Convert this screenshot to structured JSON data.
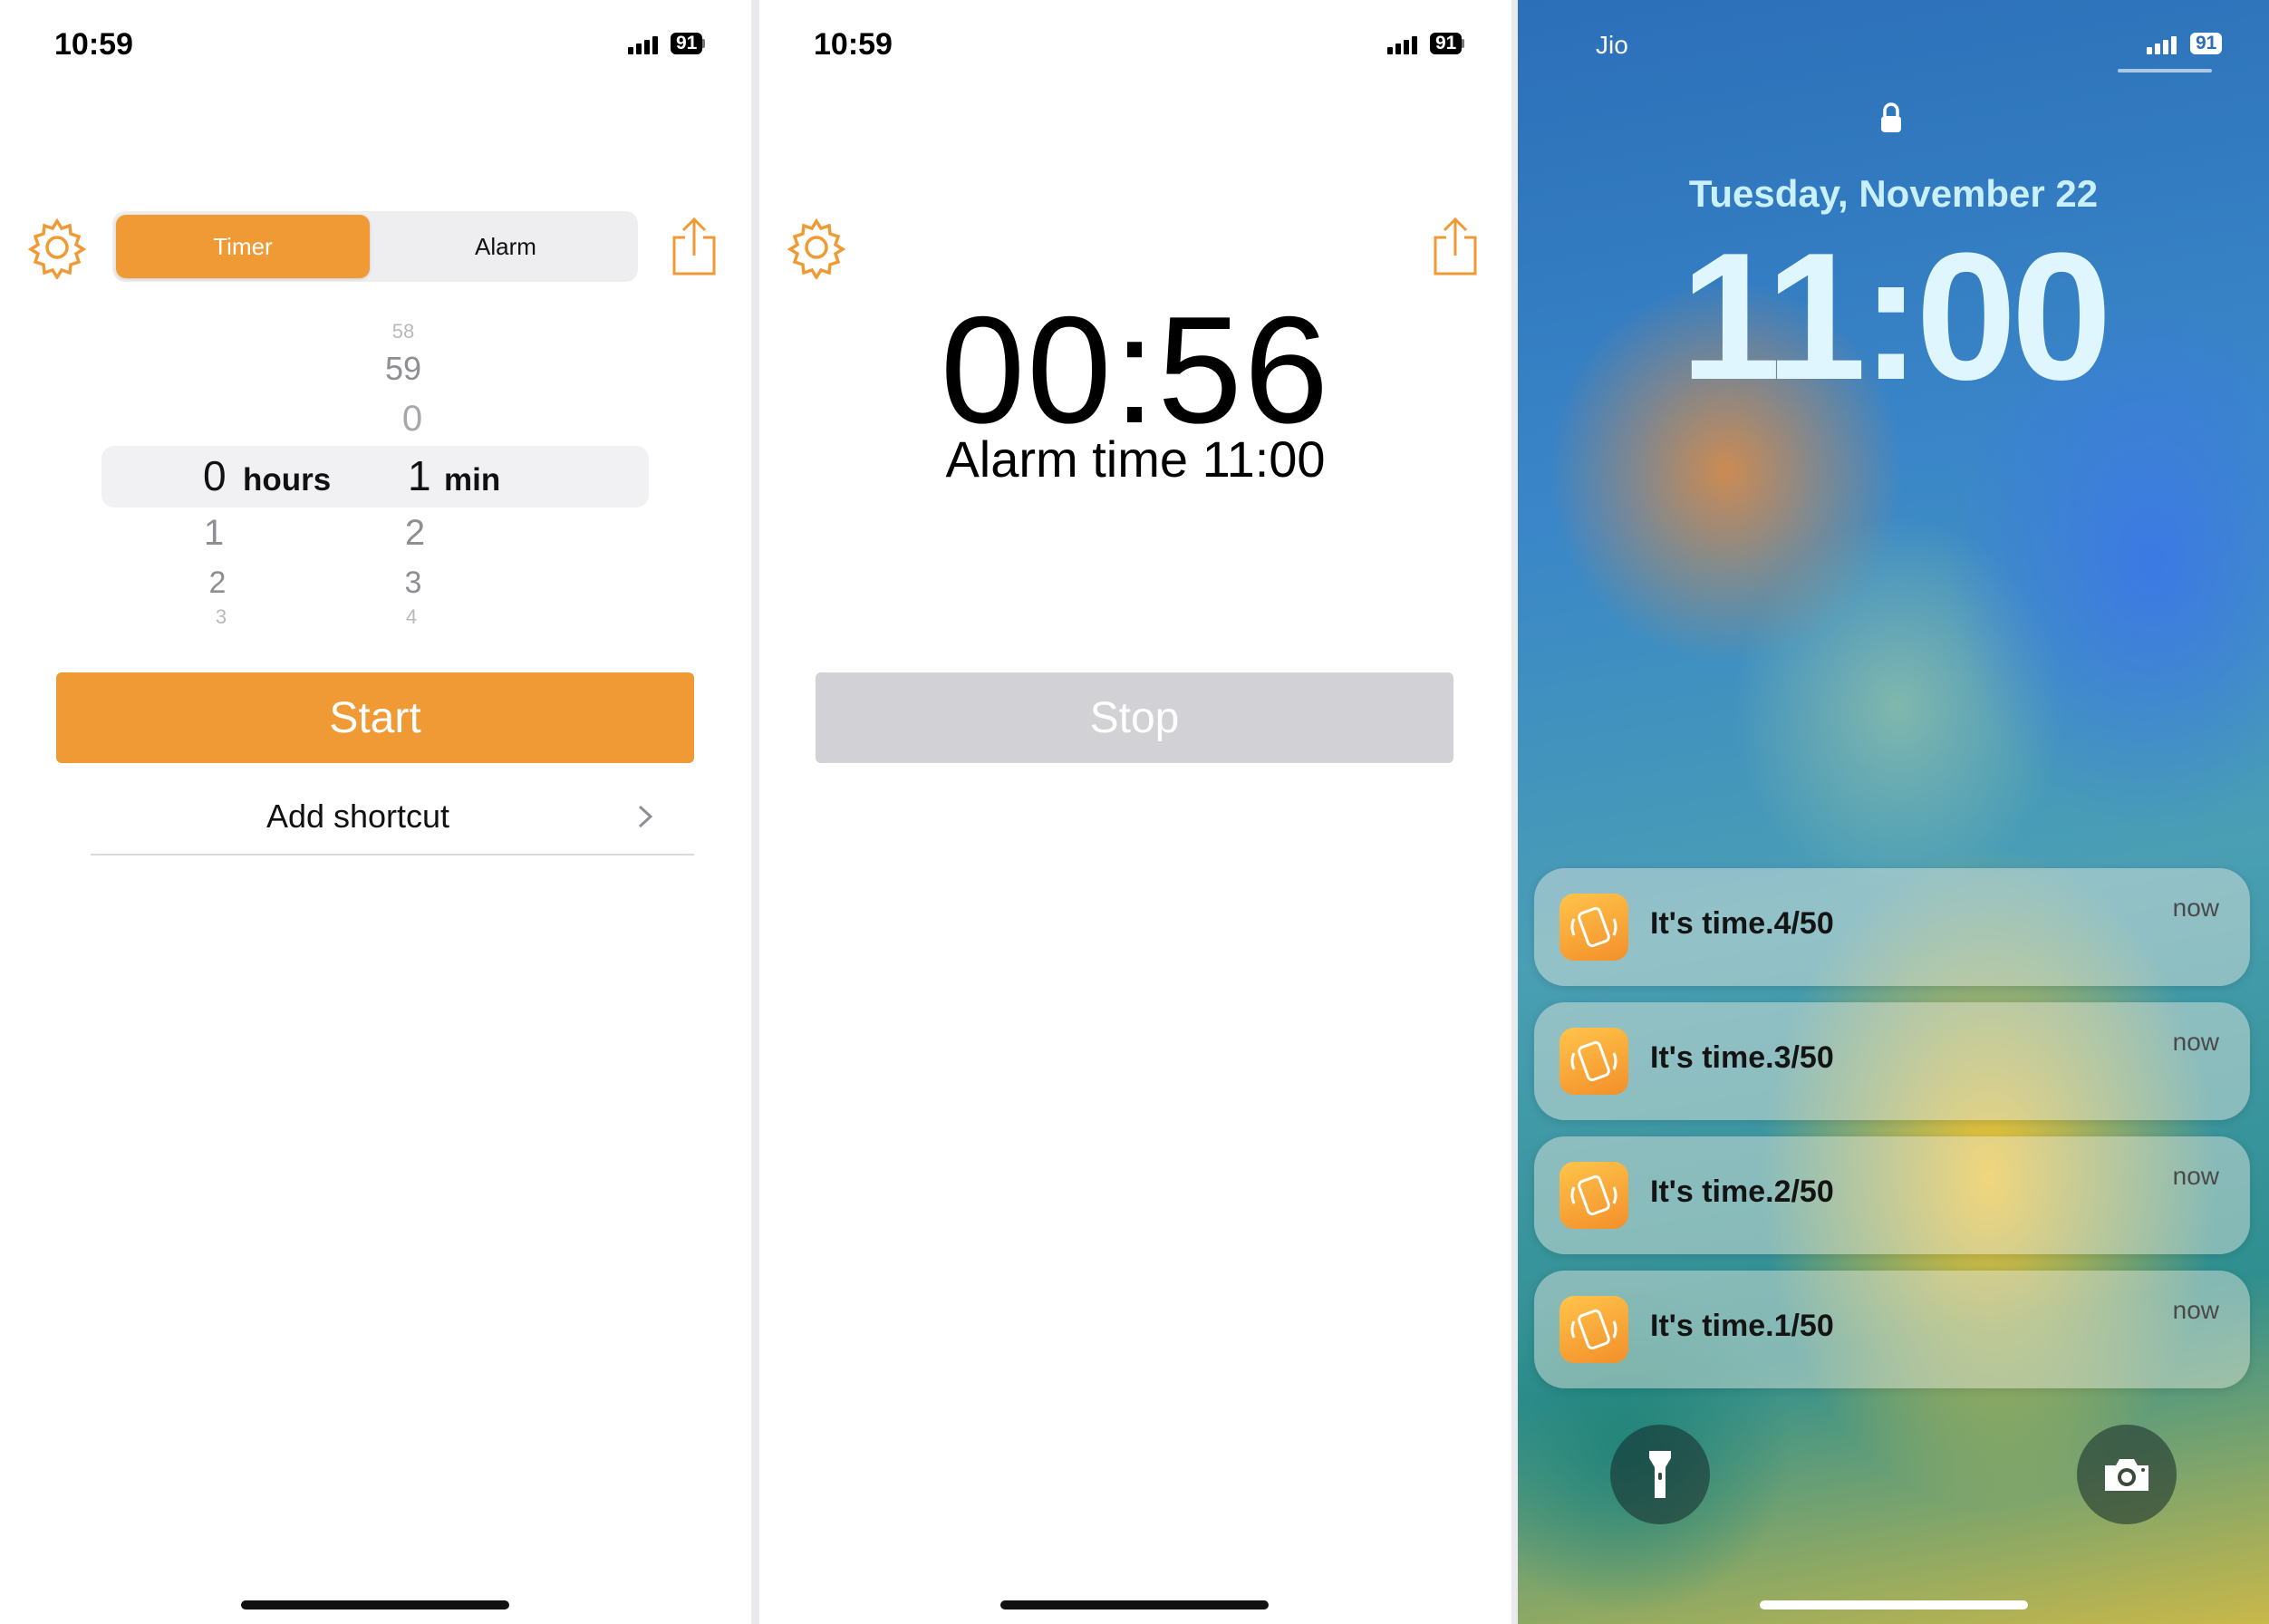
{
  "screen1": {
    "status": {
      "time": "10:59",
      "battery": "91"
    },
    "segmented": {
      "timer": "Timer",
      "alarm": "Alarm"
    },
    "picker": {
      "above": [
        "58",
        "59",
        "0"
      ],
      "hours_value": "0",
      "hours_unit": "hours",
      "min_value": "1",
      "min_unit": "min",
      "hours_below": [
        "1",
        "2",
        "3"
      ],
      "min_below": [
        "2",
        "3",
        "4"
      ]
    },
    "start_label": "Start",
    "add_shortcut_label": "Add shortcut"
  },
  "screen2": {
    "status": {
      "time": "10:59",
      "battery": "91"
    },
    "countdown": "00:56",
    "alarm_time": "Alarm time 11:00",
    "stop_label": "Stop"
  },
  "screen3": {
    "carrier": "Jio",
    "battery": "91",
    "date": "Tuesday, November 22",
    "time": "11:00",
    "notifications": [
      {
        "title": "It's time.4/50",
        "time": "now"
      },
      {
        "title": "It's time.3/50",
        "time": "now"
      },
      {
        "title": "It's time.2/50",
        "time": "now"
      },
      {
        "title": "It's time.1/50",
        "time": "now"
      }
    ]
  },
  "icons": {
    "settings": "gear-icon",
    "share": "share-icon",
    "chevron": "chevron-right-icon",
    "lock": "lock-icon",
    "flashlight": "flashlight-icon",
    "camera": "camera-icon",
    "app": "vibrating-phone-icon"
  },
  "colors": {
    "accent": "#f09a36",
    "stop_disabled": "#d1d1d6"
  }
}
